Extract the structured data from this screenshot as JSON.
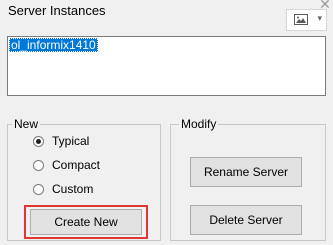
{
  "window": {
    "title": "Server Instances",
    "close_glyph": "✕"
  },
  "toolbar": {
    "image_dropdown_icon": "image-icon",
    "dropdown_chevron": "▾"
  },
  "instances": {
    "items": [
      {
        "label": "ol_informix1410",
        "selected": true
      }
    ]
  },
  "new_group": {
    "legend": "New",
    "options": [
      {
        "label": "Typical",
        "checked": true
      },
      {
        "label": "Compact",
        "checked": false
      },
      {
        "label": "Custom",
        "checked": false
      }
    ],
    "create_label": "Create New"
  },
  "modify_group": {
    "legend": "Modify",
    "rename_label": "Rename Server",
    "delete_label": "Delete Server"
  },
  "colors": {
    "selection": "#0078d7",
    "highlight": "#e03636"
  }
}
